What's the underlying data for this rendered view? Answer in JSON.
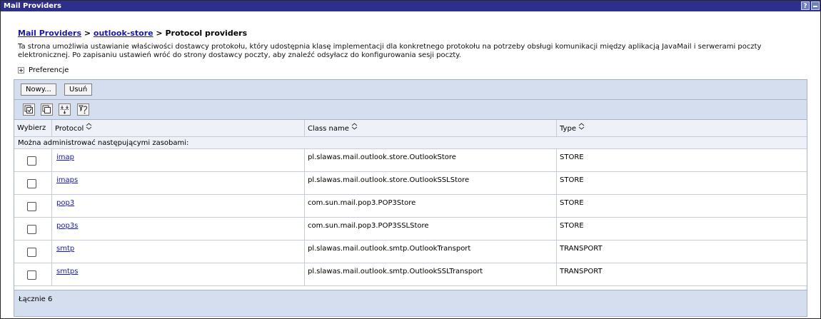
{
  "window": {
    "title": "Mail Providers",
    "help_label": "?"
  },
  "breadcrumb": {
    "link1": "Mail Providers",
    "sep1": " > ",
    "link2": "outlook-store",
    "sep2": " > ",
    "current": "Protocol providers"
  },
  "description": "Ta strona umożliwia ustawianie właściwości dostawcy protokołu, który udostępnia klasę implementacji dla konkretnego protokołu na potrzeby obsługi komunikacji między aplikacją JavaMail i serwerami poczty elektronicznej. Po zapisaniu ustawień wróć do strony dostawcy poczty, aby znaleźć odsyłacz do konfigurowania sesji poczty.",
  "preferences_label": "Preferencje",
  "toolbar": {
    "new_label": "Nowy...",
    "delete_label": "Usuń"
  },
  "icons": {
    "select_all": "select-all-icon",
    "deselect_all": "deselect-all-icon",
    "show_filter": "show-filter-icon",
    "clear_filter": "clear-filter-icon",
    "sort": "sort-icon"
  },
  "table": {
    "headers": {
      "select": "Wybierz",
      "protocol": "Protocol",
      "class_name": "Class name",
      "type": "Type"
    },
    "section_text": "Można administrować następującymi zasobami:",
    "rows": [
      {
        "protocol": "imap",
        "class_name": "pl.slawas.mail.outlook.store.OutlookStore",
        "type": "STORE"
      },
      {
        "protocol": "imaps",
        "class_name": "pl.slawas.mail.outlook.store.OutlookSSLStore",
        "type": "STORE"
      },
      {
        "protocol": "pop3",
        "class_name": "com.sun.mail.pop3.POP3Store",
        "type": "STORE"
      },
      {
        "protocol": "pop3s",
        "class_name": "com.sun.mail.pop3.POP3SSLStore",
        "type": "STORE"
      },
      {
        "protocol": "smtp",
        "class_name": "pl.slawas.mail.outlook.smtp.OutlookTransport",
        "type": "TRANSPORT"
      },
      {
        "protocol": "smtps",
        "class_name": "pl.slawas.mail.outlook.smtp.OutlookSSLTransport",
        "type": "TRANSPORT"
      }
    ],
    "total": "Łącznie 6"
  },
  "colors": {
    "titlebar": "#2d2f8b",
    "toolbar": "#d5deef",
    "link": "#1a1aa6"
  }
}
